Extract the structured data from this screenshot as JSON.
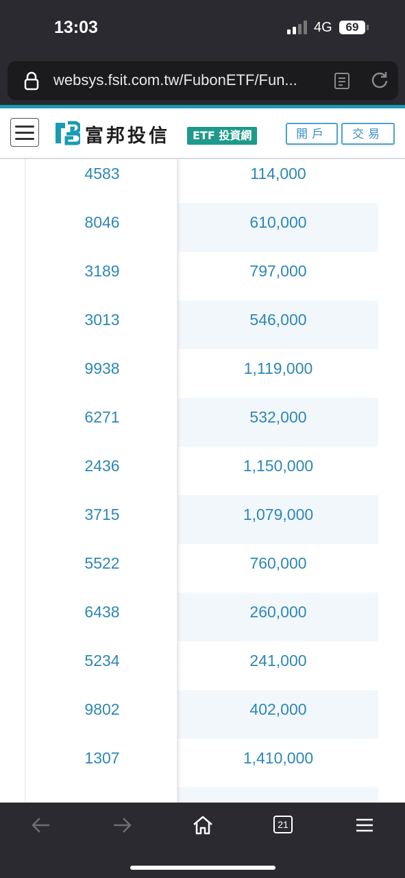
{
  "status_bar": {
    "time": "13:03",
    "network": "4G",
    "battery": "69"
  },
  "browser": {
    "url": "websys.fsit.com.tw/FubonETF/Fun...",
    "tab_count": "21"
  },
  "site_header": {
    "brand_name": "富邦投信",
    "etf_badge": "ETF 投資網",
    "open_account_label": "開戶",
    "trade_label": "交易"
  },
  "colors": {
    "link_blue": "#2d87b6",
    "accent_teal": "#1a9bb5",
    "badge_green": "#1e9a8a",
    "row_alt": "#f2f7fc"
  },
  "table": {
    "rows": [
      {
        "code": "4583",
        "qty": "114,000"
      },
      {
        "code": "8046",
        "qty": "610,000"
      },
      {
        "code": "3189",
        "qty": "797,000"
      },
      {
        "code": "3013",
        "qty": "546,000"
      },
      {
        "code": "9938",
        "qty": "1,119,000"
      },
      {
        "code": "6271",
        "qty": "532,000"
      },
      {
        "code": "2436",
        "qty": "1,150,000"
      },
      {
        "code": "3715",
        "qty": "1,079,000"
      },
      {
        "code": "5522",
        "qty": "760,000"
      },
      {
        "code": "6438",
        "qty": "260,000"
      },
      {
        "code": "5234",
        "qty": "241,000"
      },
      {
        "code": "9802",
        "qty": "402,000"
      },
      {
        "code": "1307",
        "qty": "1,410,000"
      },
      {
        "code": "",
        "qty": ""
      }
    ]
  },
  "toolbar": {
    "icons": [
      "back-arrow-icon",
      "forward-arrow-icon",
      "home-icon",
      "tabs-icon",
      "menu-icon"
    ]
  }
}
